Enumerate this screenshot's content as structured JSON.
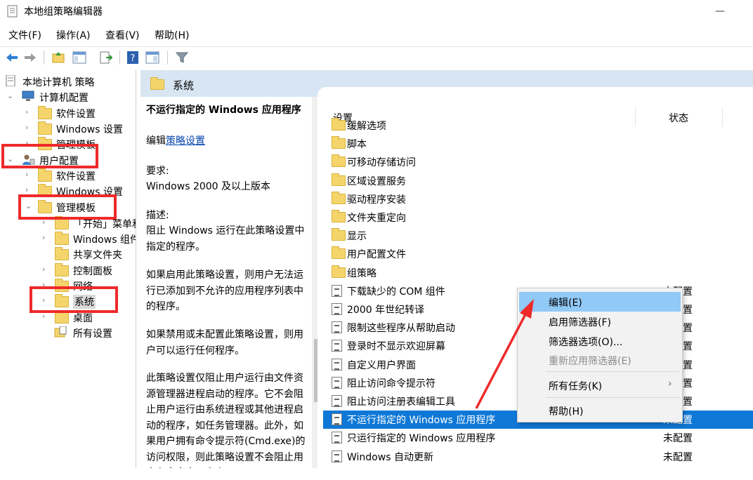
{
  "window": {
    "title": "本地组策略编辑器",
    "minimize_glyph": "—"
  },
  "menubar": [
    {
      "label": "文件(F)"
    },
    {
      "label": "操作(A)"
    },
    {
      "label": "查看(V)"
    },
    {
      "label": "帮助(H)"
    }
  ],
  "toolbar": {
    "icons": [
      "back-icon",
      "forward-icon",
      "up-folder-icon",
      "show-tree-icon",
      "export-icon",
      "help-icon",
      "properties-icon",
      "filter-icon"
    ]
  },
  "tree": {
    "root": "本地计算机 策略",
    "computer": "计算机配置",
    "c_software": "软件设置",
    "c_windows": "Windows 设置",
    "c_admin": "管理模板",
    "user": "用户配置",
    "u_software": "软件设置",
    "u_windows": "Windows 设置",
    "u_admin": "管理模板",
    "a_start": "「开始」菜单和任务栏",
    "a_wincomp": "Windows 组件",
    "a_shared": "共享文件夹",
    "a_control": "控制面板",
    "a_network": "网络",
    "a_system": "系统",
    "a_desktop": "桌面",
    "a_all": "所有设置"
  },
  "header": {
    "title": "系统"
  },
  "description": {
    "title": "不运行指定的 Windows 应用程序",
    "edit_prefix": "编辑",
    "edit_link": "策略设置",
    "req_label": "要求:",
    "req_value": "Windows 2000 及以上版本",
    "desc_label": "描述:",
    "desc1": "阻止 Windows 运行在此策略设置中指定的程序。",
    "desc2": "如果启用此策略设置，则用户无法运行已添加到不允许的应用程序列表中的程序。",
    "desc3": "如果禁用或未配置此策略设置，则用户可以运行任何程序。",
    "desc4": "此策略设置仅阻止用户运行由文件资源管理器进程启动的程序。它不会阻止用户运行由系统进程或其他进程启动的程序，如任务管理器。此外，如果用户拥有命令提示符(Cmd.exe)的访问权限，则此策略设置不会阻止用户在命令窗口中启"
  },
  "list": {
    "col_setting": "设置",
    "col_state": "状态",
    "folders": [
      "缓解选项",
      "脚本",
      "可移动存储访问",
      "区域设置服务",
      "驱动程序安装",
      "文件夹重定向",
      "显示",
      "用户配置文件",
      "组策略"
    ],
    "policies": [
      {
        "name": "下载缺少的 COM 组件",
        "state": "未配置"
      },
      {
        "name": "2000 年世纪转译",
        "state": "未配置"
      },
      {
        "name": "限制这些程序从帮助启动",
        "state": "未配置"
      },
      {
        "name": "登录时不显示欢迎屏幕",
        "state": "未配置"
      },
      {
        "name": "自定义用户界面",
        "state": "未配置"
      },
      {
        "name": "阻止访问命令提示符",
        "state": "未配置"
      },
      {
        "name": "阻止访问注册表编辑工具",
        "state": "未配置"
      },
      {
        "name": "不运行指定的 Windows 应用程序",
        "state": "未配置"
      },
      {
        "name": "只运行指定的 Windows 应用程序",
        "state": "未配置"
      },
      {
        "name": "Windows 自动更新",
        "state": "未配置"
      }
    ]
  },
  "context_menu": {
    "edit": "编辑(E)",
    "enable_filter": "启用筛选器(F)",
    "filter_options": "筛选器选项(O)...",
    "reapply_filter": "重新应用筛选器(E)",
    "all_tasks": "所有任务(K)",
    "help": "帮助(H)",
    "submenu_glyph": "›"
  },
  "colors": {
    "selection": "#0f78d7",
    "highlight_box": "#ee2a2a",
    "menu_hover": "#91c9f7",
    "header_bg": "#d8e6f3"
  }
}
